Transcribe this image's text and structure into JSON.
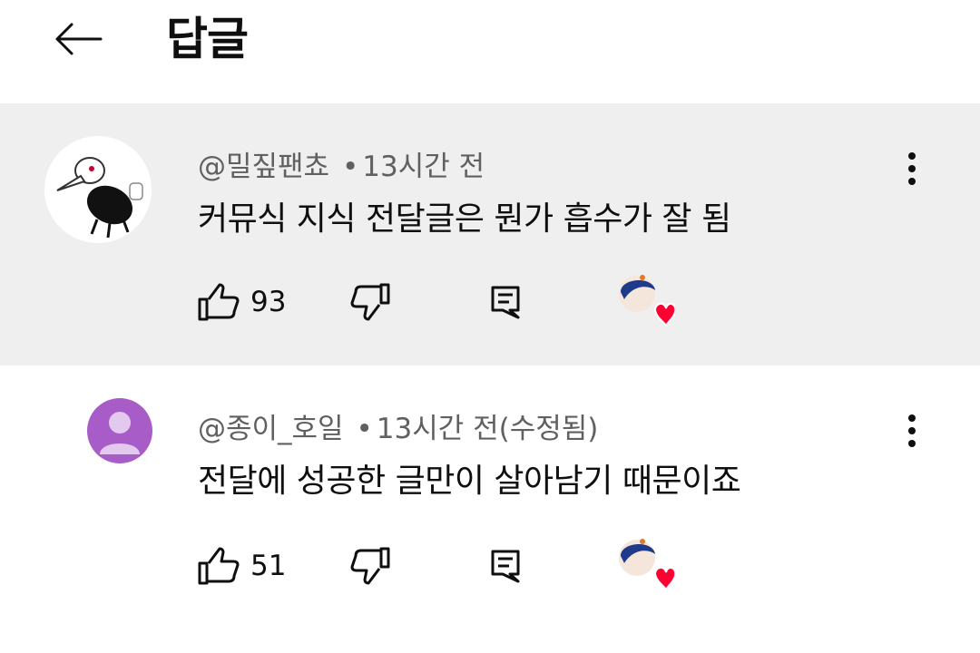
{
  "header": {
    "title": "답글",
    "back_icon": "arrow-left-icon"
  },
  "comments": [
    {
      "author": "@밀짚팬쵸",
      "separator": "•",
      "time": "13시간 전",
      "text": "커뮤식 지식 전달글은 뭔가 흡수가 잘 됨",
      "likes": "93",
      "highlighted": true,
      "avatar": "beaked-bug-avatar"
    },
    {
      "author": "@종이_호일",
      "separator": "•",
      "time": "13시간 전(수정됨)",
      "text": "전달에 성공한 글만이 살아남기 때문이죠",
      "likes": "51",
      "highlighted": false,
      "avatar": "default-purple-avatar"
    }
  ],
  "colors": {
    "highlight_bg": "#efefef",
    "meta_text": "#606060",
    "default_avatar_bg": "#a85cc8",
    "heart": "#ff0033"
  }
}
